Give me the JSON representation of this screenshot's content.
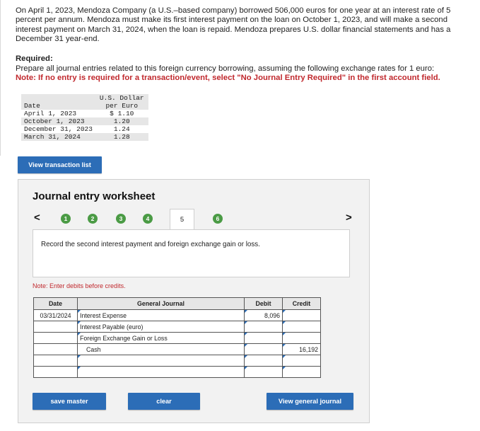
{
  "problem": {
    "intro": "On April 1, 2023, Mendoza Company (a U.S.–based company) borrowed 506,000 euros for one year at an interest rate of 5 percent per annum. Mendoza must make its first interest payment on the loan on October 1, 2023, and will make a second interest payment on March 31, 2024, when the loan is repaid. Mendoza prepares U.S. dollar financial statements and has a December 31 year-end.",
    "required_heading": "Required:",
    "required_text": "Prepare all journal entries related to this foreign currency borrowing, assuming the following exchange rates for 1 euro:",
    "note": "Note: If no entry is required for a transaction/event, select \"No Journal Entry Required\" in the first account field."
  },
  "rates_table": {
    "header_date": "Date",
    "header_rate_line1": "U.S. Dollar",
    "header_rate_line2": "per Euro",
    "rows": [
      {
        "date": "April 1, 2023",
        "rate": "$ 1.10"
      },
      {
        "date": "October 1, 2023",
        "rate": "1.20"
      },
      {
        "date": "December 31, 2023",
        "rate": "1.24"
      },
      {
        "date": "March 31, 2024",
        "rate": "1.28"
      }
    ]
  },
  "buttons": {
    "view_transaction_list": "View transaction list",
    "save_master": "save master",
    "clear": "clear",
    "view_general_journal": "View general journal"
  },
  "worksheet": {
    "title": "Journal entry worksheet",
    "nav_prev": "<",
    "nav_next": ">",
    "steps": [
      "1",
      "2",
      "3",
      "4",
      "5",
      "6"
    ],
    "current_step": "5",
    "instruction": "Record the second interest payment and foreign exchange gain or loss.",
    "debit_note": "Note: Enter debits before credits.",
    "columns": {
      "date": "Date",
      "journal": "General Journal",
      "debit": "Debit",
      "credit": "Credit"
    },
    "rows": [
      {
        "date": "03/31/2024",
        "account": "Interest Expense",
        "debit": "8,096",
        "credit": ""
      },
      {
        "date": "",
        "account": "Interest Payable (euro)",
        "debit": "",
        "credit": ""
      },
      {
        "date": "",
        "account": "Foreign Exchange Gain or Loss",
        "debit": "",
        "credit": ""
      },
      {
        "date": "",
        "account": "Cash",
        "debit": "",
        "credit": "16,192"
      },
      {
        "date": "",
        "account": "",
        "debit": "",
        "credit": ""
      },
      {
        "date": "",
        "account": "",
        "debit": "",
        "credit": ""
      }
    ]
  },
  "colors": {
    "accent": "#2c6db7",
    "step_done": "#4b9b45",
    "note_red": "#c0282d"
  }
}
